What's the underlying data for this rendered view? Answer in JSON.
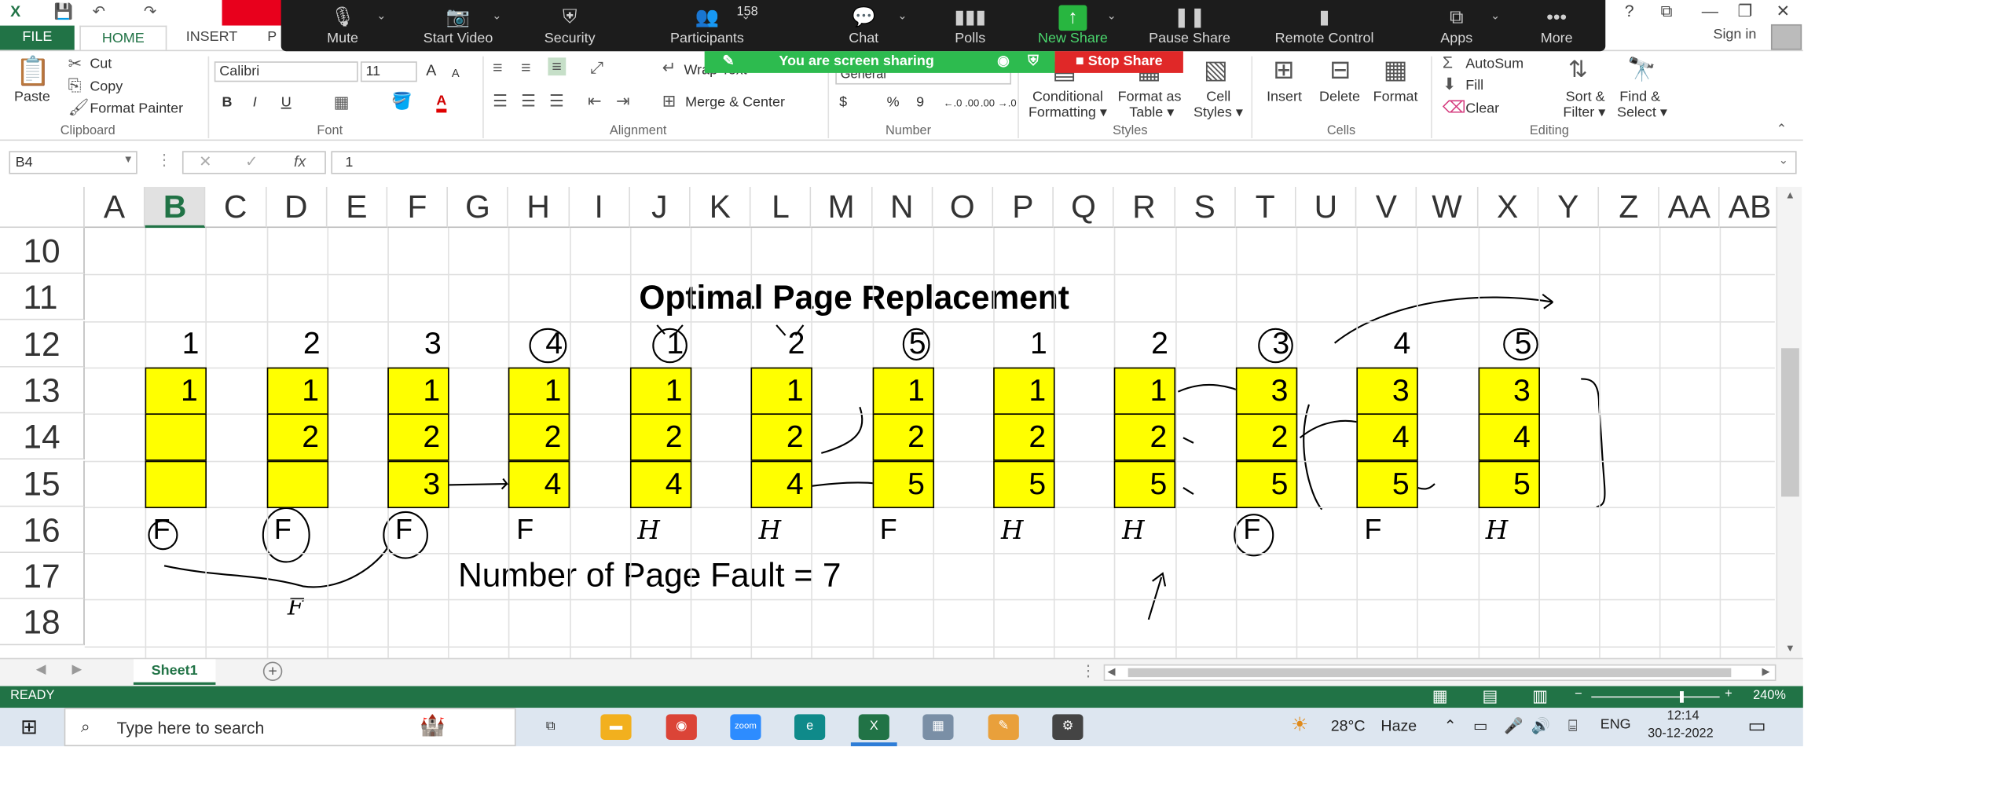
{
  "titlebar": {
    "help": "?",
    "restore_ribbon": "⧉",
    "minimize": "—",
    "maximize": "❐",
    "close": "✕"
  },
  "zoom_toolbar": {
    "buttons": [
      {
        "label": "Mute",
        "icon": "microphone-icon",
        "glyph": "🎙"
      },
      {
        "label": "Start Video",
        "icon": "video-off-icon",
        "glyph": "📷"
      },
      {
        "label": "Security",
        "icon": "shield-icon",
        "glyph": "⛨"
      },
      {
        "label": "Participants",
        "icon": "participants-icon",
        "glyph": "👥"
      },
      {
        "label": "Chat",
        "icon": "chat-icon",
        "glyph": "💬"
      },
      {
        "label": "Polls",
        "icon": "polls-icon",
        "glyph": "▮▮▮"
      },
      {
        "label": "New Share",
        "icon": "share-arrow-icon",
        "glyph": "↑"
      },
      {
        "label": "Pause Share",
        "icon": "pause-icon",
        "glyph": "❚❚"
      },
      {
        "label": "Remote Control",
        "icon": "mouse-icon",
        "glyph": "▮"
      },
      {
        "label": "Apps",
        "icon": "apps-icon",
        "glyph": "⧉"
      },
      {
        "label": "More",
        "icon": "more-icon",
        "glyph": "•••"
      }
    ],
    "participant_count": "158",
    "sharing_banner": "You are screen sharing",
    "stop_share": "Stop Share"
  },
  "tabs": {
    "file": "FILE",
    "home": "HOME",
    "insert": "INSERT",
    "hidden": "P"
  },
  "account": {
    "sign_in": "Sign in"
  },
  "ribbon": {
    "clipboard": {
      "paste": "Paste",
      "cut": "Cut",
      "copy": "Copy",
      "format_painter": "Format Painter",
      "group": "Clipboard"
    },
    "font": {
      "name": "Calibri",
      "size": "11",
      "grow": "A",
      "shrink": "A",
      "bold": "B",
      "italic": "I",
      "underline": "U",
      "color_letter": "A",
      "group": "Font"
    },
    "alignment": {
      "wrap_text": "Wrap Text",
      "merge_center": "Merge & Center",
      "group": "Alignment"
    },
    "number": {
      "format": "General",
      "currency": "$",
      "percent": "%",
      "comma": "9",
      "increase_decimal": "←.0 .00",
      "decrease_decimal": ".00 →.0",
      "group": "Number"
    },
    "styles": {
      "conditional_formatting": [
        "Conditional",
        "Formatting ▾"
      ],
      "format_as_table": [
        "Format as",
        "Table ▾"
      ],
      "cell_styles": [
        "Cell",
        "Styles ▾"
      ],
      "group": "Styles"
    },
    "cells": {
      "insert": "Insert",
      "delete": "Delete",
      "format": "Format",
      "group": "Cells"
    },
    "editing": {
      "autosum": "AutoSum",
      "fill": "Fill",
      "clear": "Clear",
      "sort_filter": [
        "Sort &",
        "Filter ▾"
      ],
      "find_select": [
        "Find &",
        "Select ▾"
      ],
      "group": "Editing"
    }
  },
  "formula_bar": {
    "name_box": "B4",
    "formula": "1",
    "fx": "fx"
  },
  "sheet": {
    "columns": [
      "A",
      "B",
      "C",
      "D",
      "E",
      "F",
      "G",
      "H",
      "I",
      "J",
      "K",
      "L",
      "M",
      "N",
      "O",
      "P",
      "Q",
      "R",
      "S",
      "T",
      "U",
      "V",
      "W",
      "X",
      "Y",
      "Z",
      "AA",
      "AB"
    ],
    "selected_column": "B",
    "rows": [
      "10",
      "11",
      "12",
      "13",
      "14",
      "15",
      "16",
      "17",
      "18"
    ],
    "title": "Optimal Page Replacement",
    "reference_string": [
      "1",
      "2",
      "3",
      "4",
      "1",
      "2",
      "5",
      "1",
      "2",
      "3",
      "4",
      "5"
    ],
    "frames": [
      [
        "1",
        "",
        ""
      ],
      [
        "1",
        "2",
        ""
      ],
      [
        "1",
        "2",
        "3"
      ],
      [
        "1",
        "2",
        "4"
      ],
      [
        "1",
        "2",
        "4"
      ],
      [
        "1",
        "2",
        "4"
      ],
      [
        "1",
        "2",
        "5"
      ],
      [
        "1",
        "2",
        "5"
      ],
      [
        "1",
        "2",
        "5"
      ],
      [
        "3",
        "2",
        "5"
      ],
      [
        "3",
        "4",
        "5"
      ],
      [
        "3",
        "4",
        "5"
      ]
    ],
    "results": [
      "F",
      "F",
      "F",
      "F",
      "H",
      "H",
      "F",
      "H",
      "H",
      "F",
      "F",
      "H"
    ],
    "summary": "Number of Page Fault = 7",
    "handwritten_note": "F",
    "frame_color": "#ffff00"
  },
  "sheet_tabs": {
    "active": "Sheet1",
    "add": "+"
  },
  "status": {
    "ready": "READY",
    "zoom": "240%",
    "zoom_minus": "−",
    "zoom_plus": "+"
  },
  "taskbar": {
    "search_placeholder": "Type here to search",
    "weather_temp": "28°C",
    "weather_desc": "Haze",
    "language": "ENG",
    "time": "12:14",
    "date": "30-12-2022",
    "apps": [
      {
        "icon": "task-view-icon",
        "color": "#3b3b3b",
        "glyph": "⧉"
      },
      {
        "icon": "file-explorer-icon",
        "color": "#f2b01e",
        "glyph": "▬"
      },
      {
        "icon": "chrome-icon",
        "color": "#db4437",
        "glyph": "◉"
      },
      {
        "icon": "zoom-icon",
        "color": "#2d8cff",
        "glyph": "zoom"
      },
      {
        "icon": "edge-icon",
        "color": "#0f8a8a",
        "glyph": "e"
      },
      {
        "icon": "excel-icon",
        "color": "#217346",
        "glyph": "X"
      },
      {
        "icon": "photos-icon",
        "color": "#7a8fa6",
        "glyph": "▦"
      },
      {
        "icon": "paint-icon",
        "color": "#e9a03b",
        "glyph": "✎"
      },
      {
        "icon": "settings-icon",
        "color": "#444444",
        "glyph": "⚙"
      }
    ]
  }
}
